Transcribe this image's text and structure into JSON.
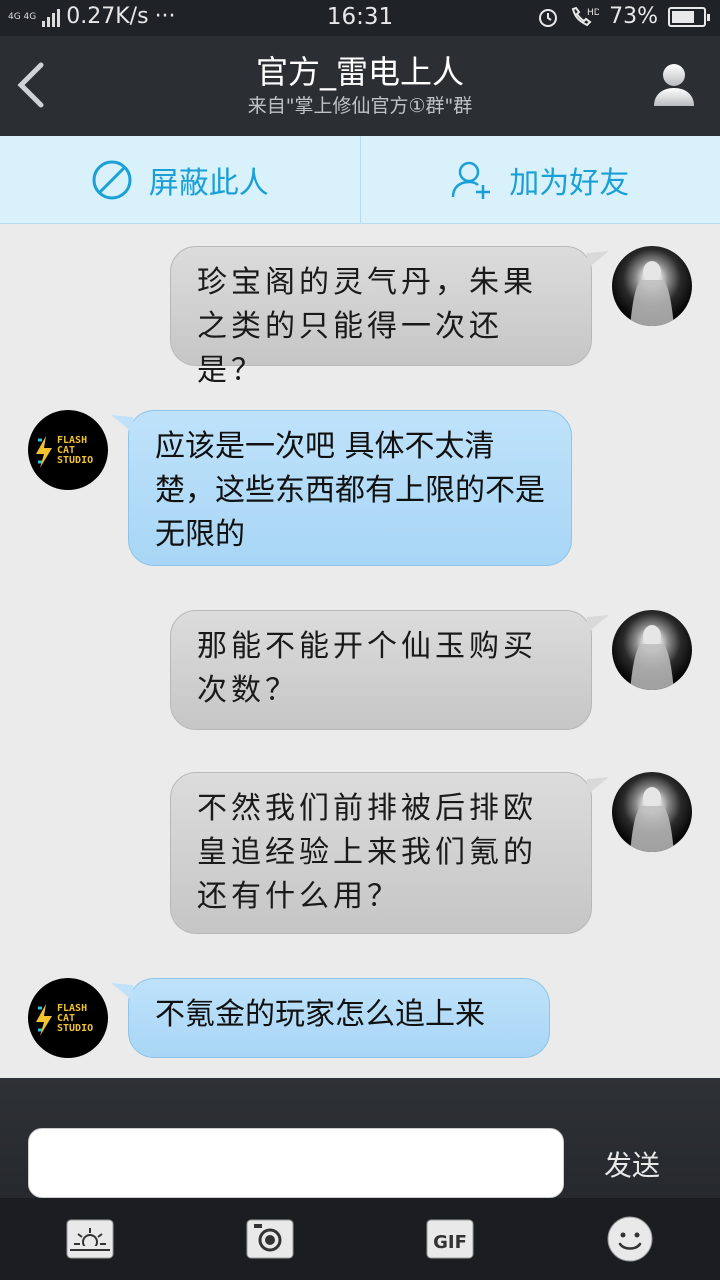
{
  "status_bar": {
    "network": "4G 4G",
    "speed": "0.27K/s",
    "more": "···",
    "time": "16:31",
    "hd": "HD",
    "battery": "73%",
    "battery_level": 0.73
  },
  "header": {
    "title": "官方_雷电上人",
    "subtitle": "来自\"掌上修仙官方①群\"群",
    "back_icon": "chevron-left-icon",
    "profile_icon": "person-icon"
  },
  "actions": {
    "block_label": "屏蔽此人",
    "add_friend_label": "加为好友"
  },
  "messages": [
    {
      "side": "right",
      "avatar": "ghost",
      "text": "珍宝阁的灵气丹，朱果之类的只能得一次还是？"
    },
    {
      "side": "left",
      "avatar": "flash",
      "text": "应该是一次吧 具体不太清楚，这些东西都有上限的不是无限的"
    },
    {
      "side": "right",
      "avatar": "ghost",
      "text": "那能不能开个仙玉购买次数？"
    },
    {
      "side": "right",
      "avatar": "ghost",
      "text": "不然我们前排被后排欧皇追经验上来我们氪的还有什么用？"
    },
    {
      "side": "left",
      "avatar": "flash",
      "text": "不氪金的玩家怎么追上来"
    }
  ],
  "flash_logo": {
    "line1": "FLASH",
    "line2": "CAT",
    "line3": "STUDIO"
  },
  "input": {
    "value": "",
    "send_label": "发送"
  },
  "toolbar": {
    "gif_label": "GIF"
  },
  "colors": {
    "header": "#2b2e33",
    "action_bar": "#d9f1fb",
    "accent": "#1aa0d6",
    "bubble_blue": "#b3dcf8",
    "bubble_grey": "#d2d2d2"
  }
}
